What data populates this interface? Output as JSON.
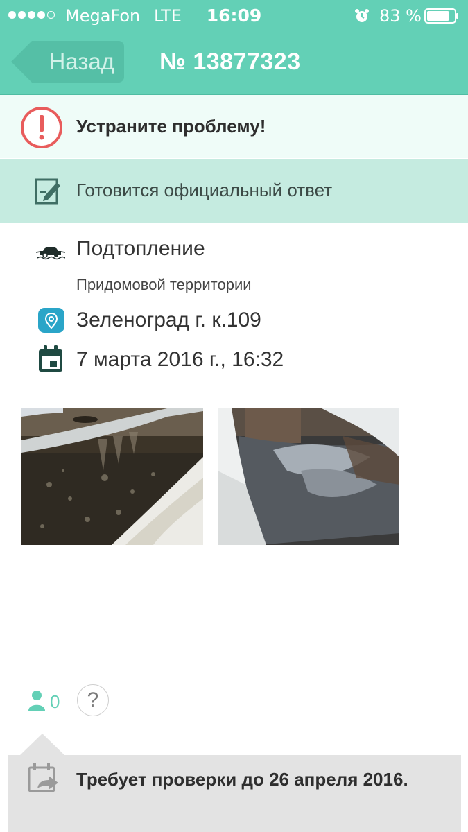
{
  "status_bar": {
    "carrier": "MegaFon",
    "network": "LTE",
    "time": "16:09",
    "battery": "83 %",
    "battery_level": 0.83,
    "signal_bars_filled": 4,
    "signal_bars_total": 5,
    "alarm_icon": "alarm-clock-icon"
  },
  "nav": {
    "back_label": "Назад",
    "title": "№ 13877323"
  },
  "alert": {
    "icon": "exclamation-circle-icon",
    "text": "Устраните проблему!"
  },
  "status": {
    "icon": "edit-document-icon",
    "text": "Готовится официальный ответ"
  },
  "details": {
    "category_icon": "car-flood-icon",
    "category": "Подтопление",
    "subcategory": "Придомовой территории",
    "address_icon": "map-pin-icon",
    "address": "Зеленоград г. к.109",
    "date_icon": "calendar-icon",
    "date": "7 марта 2016 г., 16:32"
  },
  "photos": [
    {
      "icon": "photo-thumbnail"
    },
    {
      "icon": "photo-thumbnail"
    }
  ],
  "votes": {
    "icon": "user-icon",
    "count": "0",
    "help_label": "?"
  },
  "deadline": {
    "icon": "calendar-forward-icon",
    "text": "Требует проверки до 26 апреля 2016."
  },
  "colors": {
    "accent": "#63d0b6",
    "alert_red": "#e85c5c",
    "status_bg": "#c5ebe0",
    "alert_bg": "#effcf8",
    "deadline_bg": "#e3e3e3",
    "pin_blue": "#2aa5c8"
  }
}
